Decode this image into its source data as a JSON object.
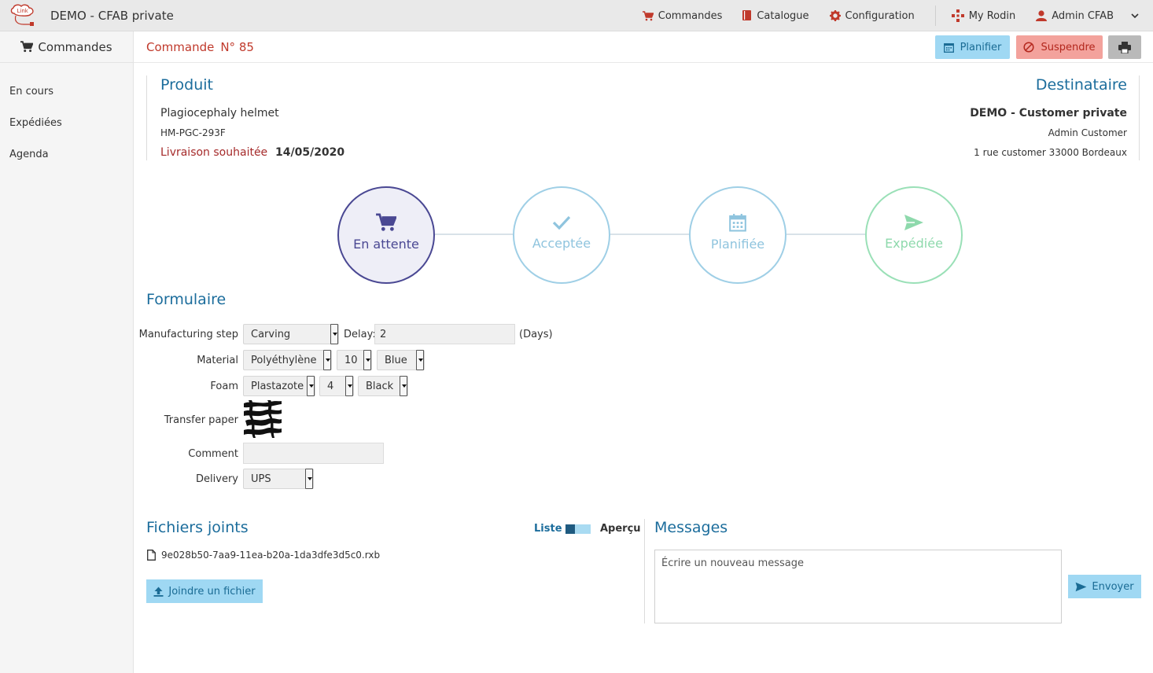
{
  "app": {
    "title": "DEMO - CFAB private"
  },
  "topnav": {
    "commandes": "Commandes",
    "catalogue": "Catalogue",
    "configuration": "Configuration",
    "my_rodin": "My Rodin",
    "user": "Admin CFAB"
  },
  "sidebar": {
    "header": "Commandes",
    "items": [
      {
        "label": "En cours"
      },
      {
        "label": "Expédiées"
      },
      {
        "label": "Agenda"
      }
    ]
  },
  "order": {
    "title_label": "Commande",
    "number": "N° 85",
    "actions": {
      "plan": "Planifier",
      "suspend": "Suspendre"
    }
  },
  "product": {
    "heading": "Produit",
    "name": "Plagiocephaly helmet",
    "ref": "HM-PGC-293F",
    "delivery_label": "Livraison souhaitée",
    "delivery_date": "14/05/2020"
  },
  "recipient": {
    "heading": "Destinataire",
    "name": "DEMO - Customer private",
    "contact": "Admin Customer",
    "address": "1 rue customer 33000 Bordeaux"
  },
  "steps": [
    {
      "label": "En attente",
      "icon": "cart-icon",
      "active": true
    },
    {
      "label": "Acceptée",
      "icon": "check-icon",
      "active": false
    },
    {
      "label": "Planifiée",
      "icon": "calendar-icon",
      "active": false
    },
    {
      "label": "Expédiée",
      "icon": "send-icon",
      "active": false
    }
  ],
  "form": {
    "heading": "Formulaire",
    "manufacturing_step": {
      "label": "Manufacturing step",
      "value": "Carving"
    },
    "delay": {
      "label": "Delay:",
      "value": "2",
      "unit": "(Days)"
    },
    "material": {
      "label": "Material",
      "type": "Polyéthylène",
      "thickness": "10",
      "color": "Blue"
    },
    "foam": {
      "label": "Foam",
      "type": "Plastazote",
      "thickness": "4",
      "color": "Black"
    },
    "transfer_paper": {
      "label": "Transfer paper",
      "pattern": "zebra"
    },
    "comment": {
      "label": "Comment",
      "value": ""
    },
    "delivery": {
      "label": "Delivery",
      "value": "UPS"
    }
  },
  "files": {
    "heading": "Fichiers joints",
    "view_list": "Liste",
    "view_preview": "Aperçu",
    "items": [
      {
        "name": "9e028b50-7aa9-11ea-b20a-1da3dfe3d5c0.rxb"
      }
    ],
    "attach_button": "Joindre un fichier"
  },
  "messages": {
    "heading": "Messages",
    "placeholder": "Écrire un nouveau message",
    "send_button": "Envoyer"
  },
  "colors": {
    "accent_blue": "#1c6d9c",
    "accent_red": "#c0392b",
    "step_active": "#4a4893",
    "step_pending": "#9fcfe6",
    "step_shipped": "#9ae0b7"
  }
}
